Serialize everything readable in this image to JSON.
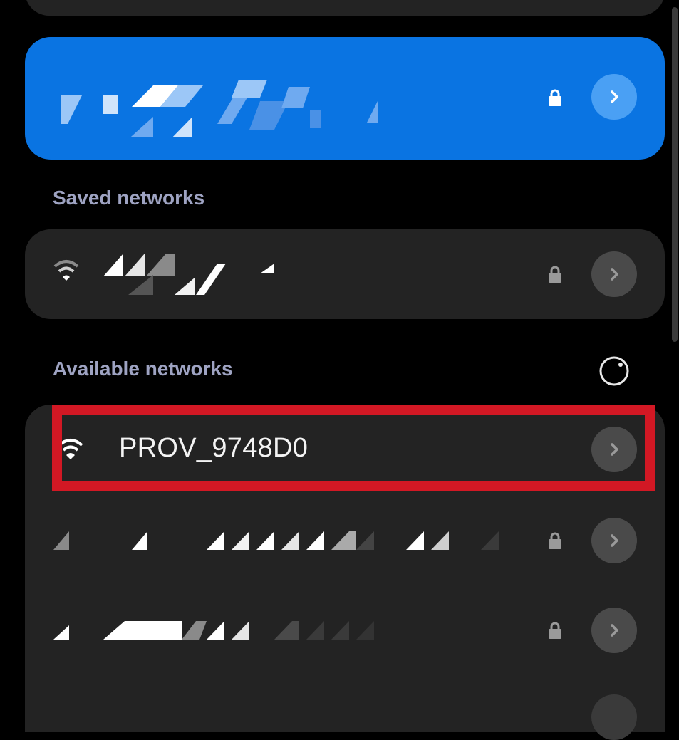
{
  "sections": {
    "saved_label": "Saved networks",
    "available_label": "Available networks"
  },
  "available_networks": [
    {
      "ssid": "PROV_9748D0",
      "secured": false,
      "highlighted": true
    }
  ],
  "icons": {
    "wifi": "wifi-icon",
    "lock": "lock-icon",
    "chevron": "chevron-right-icon",
    "refresh": "refresh-icon"
  },
  "colors": {
    "background": "#000000",
    "card": "#232323",
    "connected_card": "#0a74e2",
    "section_label": "#9ea3c2",
    "highlight_box": "#d21824"
  }
}
